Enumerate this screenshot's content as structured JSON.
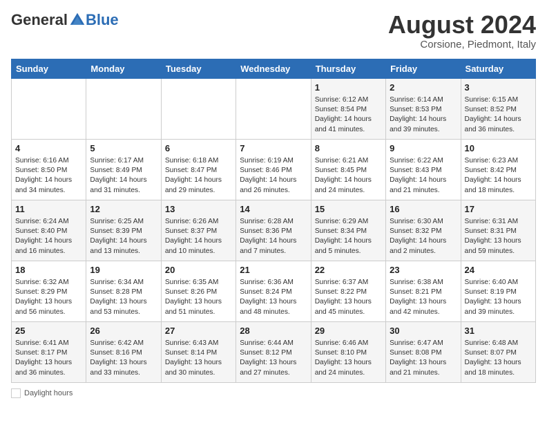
{
  "header": {
    "logo_general": "General",
    "logo_blue": "Blue",
    "month_title": "August 2024",
    "location": "Corsione, Piedmont, Italy"
  },
  "calendar": {
    "days_of_week": [
      "Sunday",
      "Monday",
      "Tuesday",
      "Wednesday",
      "Thursday",
      "Friday",
      "Saturday"
    ],
    "weeks": [
      [
        {
          "day": "",
          "info": ""
        },
        {
          "day": "",
          "info": ""
        },
        {
          "day": "",
          "info": ""
        },
        {
          "day": "",
          "info": ""
        },
        {
          "day": "1",
          "info": "Sunrise: 6:12 AM\nSunset: 8:54 PM\nDaylight: 14 hours and 41 minutes."
        },
        {
          "day": "2",
          "info": "Sunrise: 6:14 AM\nSunset: 8:53 PM\nDaylight: 14 hours and 39 minutes."
        },
        {
          "day": "3",
          "info": "Sunrise: 6:15 AM\nSunset: 8:52 PM\nDaylight: 14 hours and 36 minutes."
        }
      ],
      [
        {
          "day": "4",
          "info": "Sunrise: 6:16 AM\nSunset: 8:50 PM\nDaylight: 14 hours and 34 minutes."
        },
        {
          "day": "5",
          "info": "Sunrise: 6:17 AM\nSunset: 8:49 PM\nDaylight: 14 hours and 31 minutes."
        },
        {
          "day": "6",
          "info": "Sunrise: 6:18 AM\nSunset: 8:47 PM\nDaylight: 14 hours and 29 minutes."
        },
        {
          "day": "7",
          "info": "Sunrise: 6:19 AM\nSunset: 8:46 PM\nDaylight: 14 hours and 26 minutes."
        },
        {
          "day": "8",
          "info": "Sunrise: 6:21 AM\nSunset: 8:45 PM\nDaylight: 14 hours and 24 minutes."
        },
        {
          "day": "9",
          "info": "Sunrise: 6:22 AM\nSunset: 8:43 PM\nDaylight: 14 hours and 21 minutes."
        },
        {
          "day": "10",
          "info": "Sunrise: 6:23 AM\nSunset: 8:42 PM\nDaylight: 14 hours and 18 minutes."
        }
      ],
      [
        {
          "day": "11",
          "info": "Sunrise: 6:24 AM\nSunset: 8:40 PM\nDaylight: 14 hours and 16 minutes."
        },
        {
          "day": "12",
          "info": "Sunrise: 6:25 AM\nSunset: 8:39 PM\nDaylight: 14 hours and 13 minutes."
        },
        {
          "day": "13",
          "info": "Sunrise: 6:26 AM\nSunset: 8:37 PM\nDaylight: 14 hours and 10 minutes."
        },
        {
          "day": "14",
          "info": "Sunrise: 6:28 AM\nSunset: 8:36 PM\nDaylight: 14 hours and 7 minutes."
        },
        {
          "day": "15",
          "info": "Sunrise: 6:29 AM\nSunset: 8:34 PM\nDaylight: 14 hours and 5 minutes."
        },
        {
          "day": "16",
          "info": "Sunrise: 6:30 AM\nSunset: 8:32 PM\nDaylight: 14 hours and 2 minutes."
        },
        {
          "day": "17",
          "info": "Sunrise: 6:31 AM\nSunset: 8:31 PM\nDaylight: 13 hours and 59 minutes."
        }
      ],
      [
        {
          "day": "18",
          "info": "Sunrise: 6:32 AM\nSunset: 8:29 PM\nDaylight: 13 hours and 56 minutes."
        },
        {
          "day": "19",
          "info": "Sunrise: 6:34 AM\nSunset: 8:28 PM\nDaylight: 13 hours and 53 minutes."
        },
        {
          "day": "20",
          "info": "Sunrise: 6:35 AM\nSunset: 8:26 PM\nDaylight: 13 hours and 51 minutes."
        },
        {
          "day": "21",
          "info": "Sunrise: 6:36 AM\nSunset: 8:24 PM\nDaylight: 13 hours and 48 minutes."
        },
        {
          "day": "22",
          "info": "Sunrise: 6:37 AM\nSunset: 8:22 PM\nDaylight: 13 hours and 45 minutes."
        },
        {
          "day": "23",
          "info": "Sunrise: 6:38 AM\nSunset: 8:21 PM\nDaylight: 13 hours and 42 minutes."
        },
        {
          "day": "24",
          "info": "Sunrise: 6:40 AM\nSunset: 8:19 PM\nDaylight: 13 hours and 39 minutes."
        }
      ],
      [
        {
          "day": "25",
          "info": "Sunrise: 6:41 AM\nSunset: 8:17 PM\nDaylight: 13 hours and 36 minutes."
        },
        {
          "day": "26",
          "info": "Sunrise: 6:42 AM\nSunset: 8:16 PM\nDaylight: 13 hours and 33 minutes."
        },
        {
          "day": "27",
          "info": "Sunrise: 6:43 AM\nSunset: 8:14 PM\nDaylight: 13 hours and 30 minutes."
        },
        {
          "day": "28",
          "info": "Sunrise: 6:44 AM\nSunset: 8:12 PM\nDaylight: 13 hours and 27 minutes."
        },
        {
          "day": "29",
          "info": "Sunrise: 6:46 AM\nSunset: 8:10 PM\nDaylight: 13 hours and 24 minutes."
        },
        {
          "day": "30",
          "info": "Sunrise: 6:47 AM\nSunset: 8:08 PM\nDaylight: 13 hours and 21 minutes."
        },
        {
          "day": "31",
          "info": "Sunrise: 6:48 AM\nSunset: 8:07 PM\nDaylight: 13 hours and 18 minutes."
        }
      ]
    ]
  },
  "legend": {
    "daylight_label": "Daylight hours"
  }
}
